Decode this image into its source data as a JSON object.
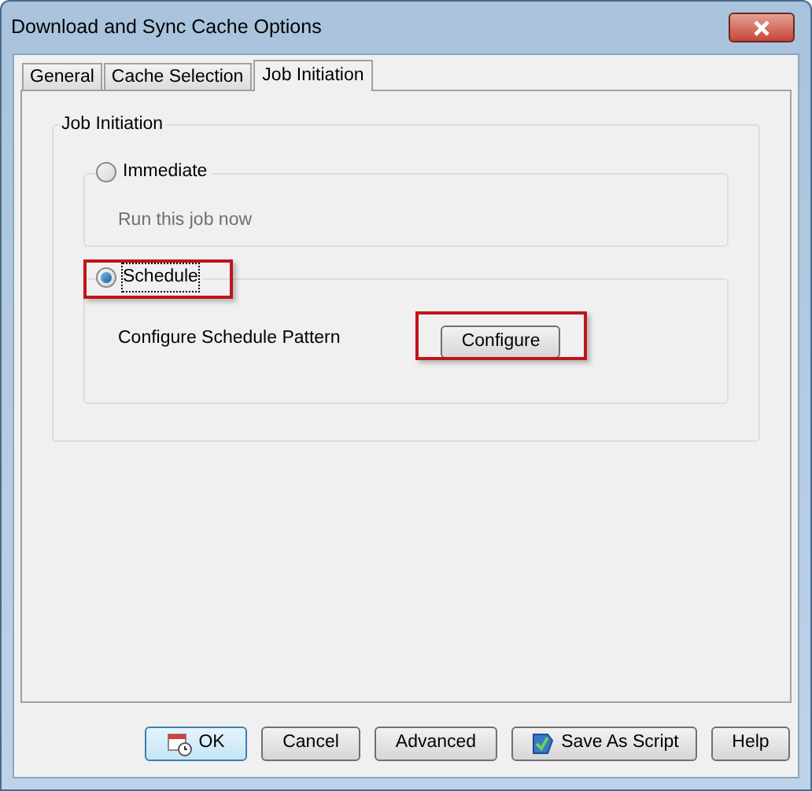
{
  "window": {
    "title": "Download and Sync Cache Options"
  },
  "tabs": [
    {
      "label": "General",
      "selected": false
    },
    {
      "label": "Cache Selection",
      "selected": false
    },
    {
      "label": "Job Initiation",
      "selected": true
    }
  ],
  "group": {
    "title": "Job Initiation",
    "options": [
      {
        "label": "Immediate",
        "selected": false,
        "highlighted": false,
        "description": "Run this job now"
      },
      {
        "label": "Schedule",
        "selected": true,
        "highlighted": true,
        "description": "Configure Schedule Pattern",
        "button": {
          "label": "Configure",
          "highlighted": true
        }
      }
    ]
  },
  "buttons": [
    {
      "label": "OK",
      "kind": "calendar",
      "default": true
    },
    {
      "label": "Cancel",
      "kind": "plain",
      "default": false
    },
    {
      "label": "Advanced",
      "kind": "plain",
      "default": false
    },
    {
      "label": "Save As Script",
      "kind": "script",
      "default": false
    },
    {
      "label": "Help",
      "kind": "plain",
      "default": false
    }
  ]
}
